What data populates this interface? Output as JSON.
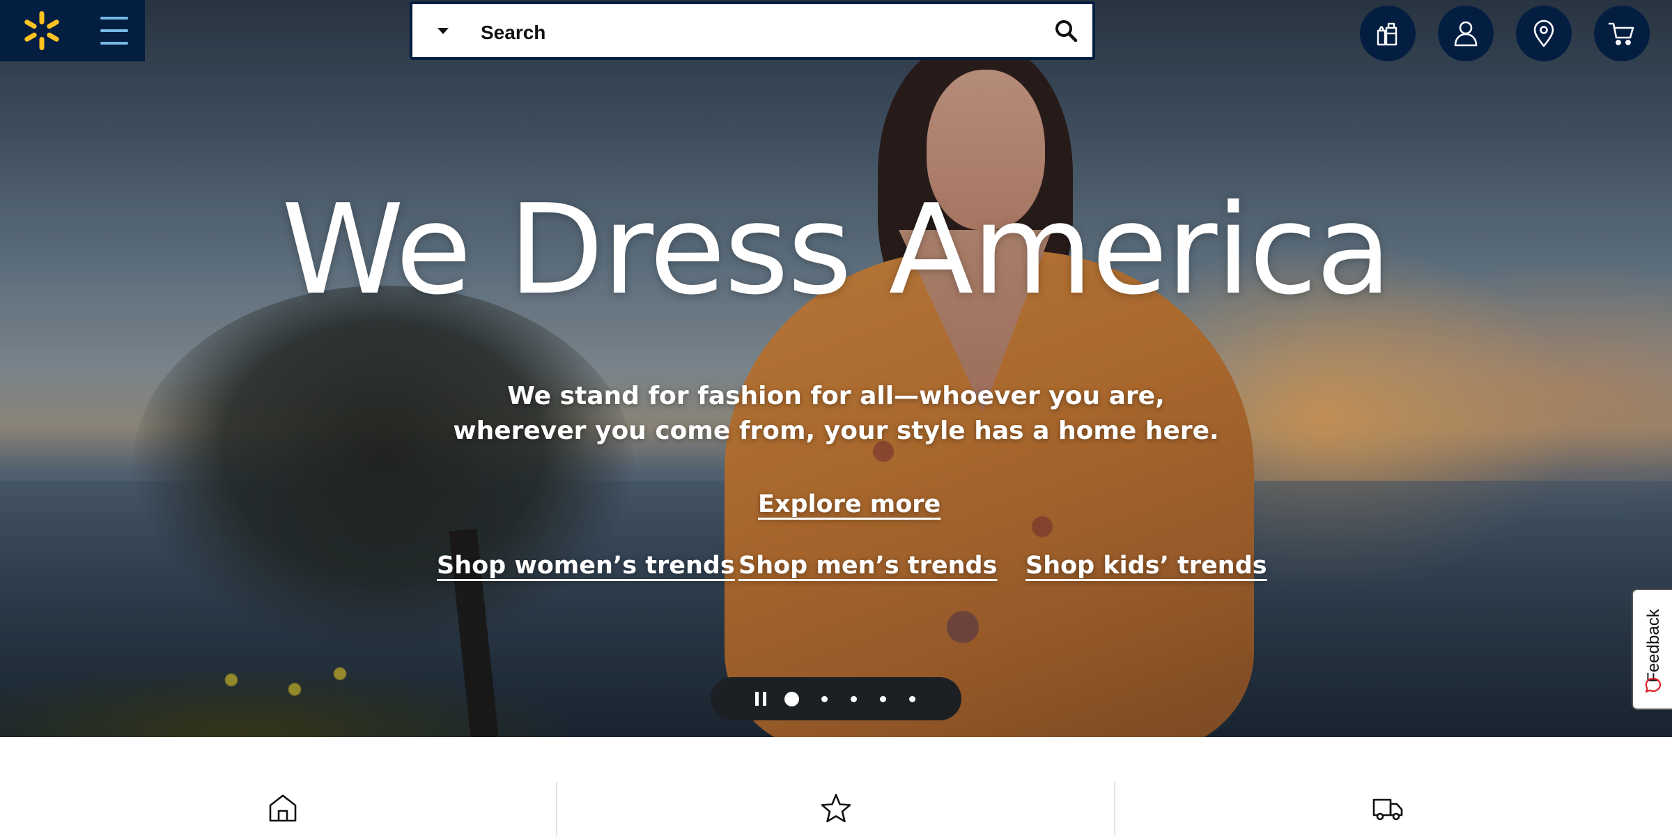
{
  "header": {
    "menu_icon": "hamburger-icon",
    "logo_icon": "spark-icon",
    "brand_color": "#041e42",
    "spark_color": "#ffc220",
    "search": {
      "placeholder": "Search",
      "department_icon": "caret-down-icon",
      "submit_icon": "search-icon"
    },
    "actions": [
      {
        "name": "reorder",
        "icon": "reorder-icon"
      },
      {
        "name": "account",
        "icon": "person-icon"
      },
      {
        "name": "store-finder",
        "icon": "location-pin-icon"
      },
      {
        "name": "cart",
        "icon": "cart-icon"
      }
    ]
  },
  "hero": {
    "headline": "We Dress America",
    "subtitle_line1": "We stand for fashion for all—whoever you are,",
    "subtitle_line2": "wherever you come from, your style has a home here.",
    "explore_link": "Explore more",
    "shop_links": {
      "women": "Shop women’s trends",
      "men": "Shop men’s trends",
      "kids": "Shop kids’ trends"
    }
  },
  "carousel": {
    "pause_icon": "pause-icon",
    "slide_count": 5,
    "active_slide": 1
  },
  "feedback": {
    "label": "Feedback",
    "icon": "chat-bubble-icon",
    "icon_color": "#de1c24"
  },
  "bottom_strip": {
    "icons": [
      "store-icon",
      "star-icon",
      "delivery-truck-icon"
    ]
  }
}
